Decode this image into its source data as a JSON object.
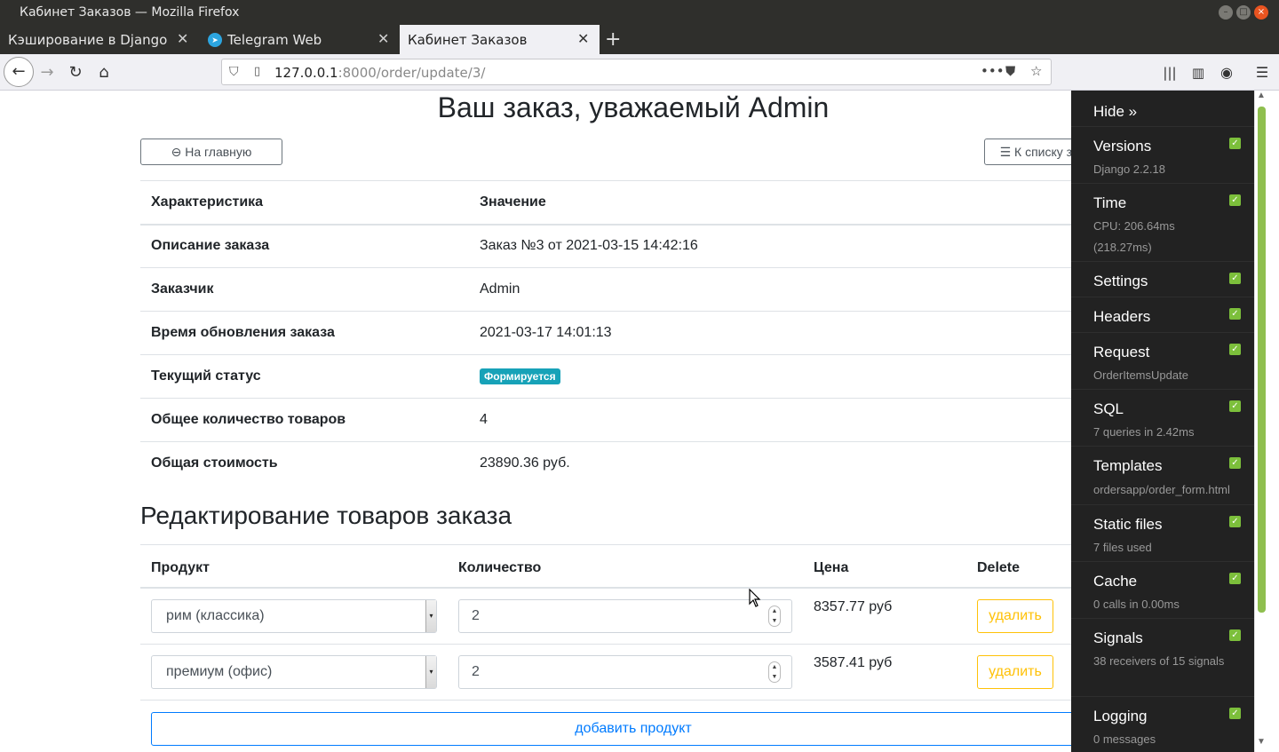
{
  "window": {
    "title": "Кабинет Заказов — Mozilla Firefox",
    "controls": [
      "minimize",
      "maximize",
      "close"
    ]
  },
  "tabs": [
    {
      "label": "Кэширование в Django",
      "active": false
    },
    {
      "label": "Telegram Web",
      "active": false,
      "icon": "telegram-icon"
    },
    {
      "label": "Кабинет Заказов",
      "active": true
    }
  ],
  "nav": {
    "url_host": "127.0.0.1",
    "url_rest": ":8000/order/update/3/",
    "icons": [
      "back-icon",
      "forward-icon",
      "reload-icon",
      "home-icon",
      "shield-icon",
      "page-icon",
      "more-icon",
      "pocket-icon",
      "star-icon",
      "library-icon",
      "sidebar-icon",
      "account-icon",
      "menu-icon"
    ]
  },
  "page": {
    "heading": "Ваш заказ, уважаемый Admin",
    "home_button": "На главную",
    "orders_button": "К списку заказов",
    "info_header": {
      "key": "Характеристика",
      "value": "Значение"
    },
    "info": [
      {
        "key": "Описание заказа",
        "value": "Заказ №3 от 2021-03-15 14:42:16"
      },
      {
        "key": "Заказчик",
        "value": "Admin"
      },
      {
        "key": "Время обновления заказа",
        "value": "2021-03-17 14:01:13"
      },
      {
        "key": "Текущий статус",
        "badge": "Формируется"
      },
      {
        "key": "Общее количество товаров",
        "value": "4"
      },
      {
        "key": "Общая стоимость",
        "value": "23890.36 руб."
      }
    ],
    "status_color": "#17a2b8",
    "items_heading": "Редактирование товаров заказа",
    "items_columns": {
      "product": "Продукт",
      "qty": "Количество",
      "price": "Цена",
      "delete": "Delete"
    },
    "items": [
      {
        "product": "рим (классика)",
        "qty": "2",
        "price": "8357.77 руб",
        "delete": "удалить"
      },
      {
        "product": "премиум (офис)",
        "qty": "2",
        "price": "3587.41 руб",
        "delete": "удалить"
      }
    ],
    "add_button": "добавить продукт"
  },
  "debug_toolbar": {
    "hide": "Hide »",
    "panels": [
      {
        "title": "Versions",
        "sub": "Django 2.2.18"
      },
      {
        "title": "Time",
        "sub": "CPU: 206.64ms (218.27ms)"
      },
      {
        "title": "Settings",
        "sub": ""
      },
      {
        "title": "Headers",
        "sub": ""
      },
      {
        "title": "Request",
        "sub": "OrderItemsUpdate"
      },
      {
        "title": "SQL",
        "sub": "7 queries in 2.42ms"
      },
      {
        "title": "Templates",
        "sub": "ordersapp/order_form.html"
      },
      {
        "title": "Static files",
        "sub": "7 files used"
      },
      {
        "title": "Cache",
        "sub": "0 calls in 0.00ms"
      },
      {
        "title": "Signals",
        "sub": "38 receivers of 15 signals"
      },
      {
        "title": "Logging",
        "sub": "0 messages"
      }
    ]
  }
}
